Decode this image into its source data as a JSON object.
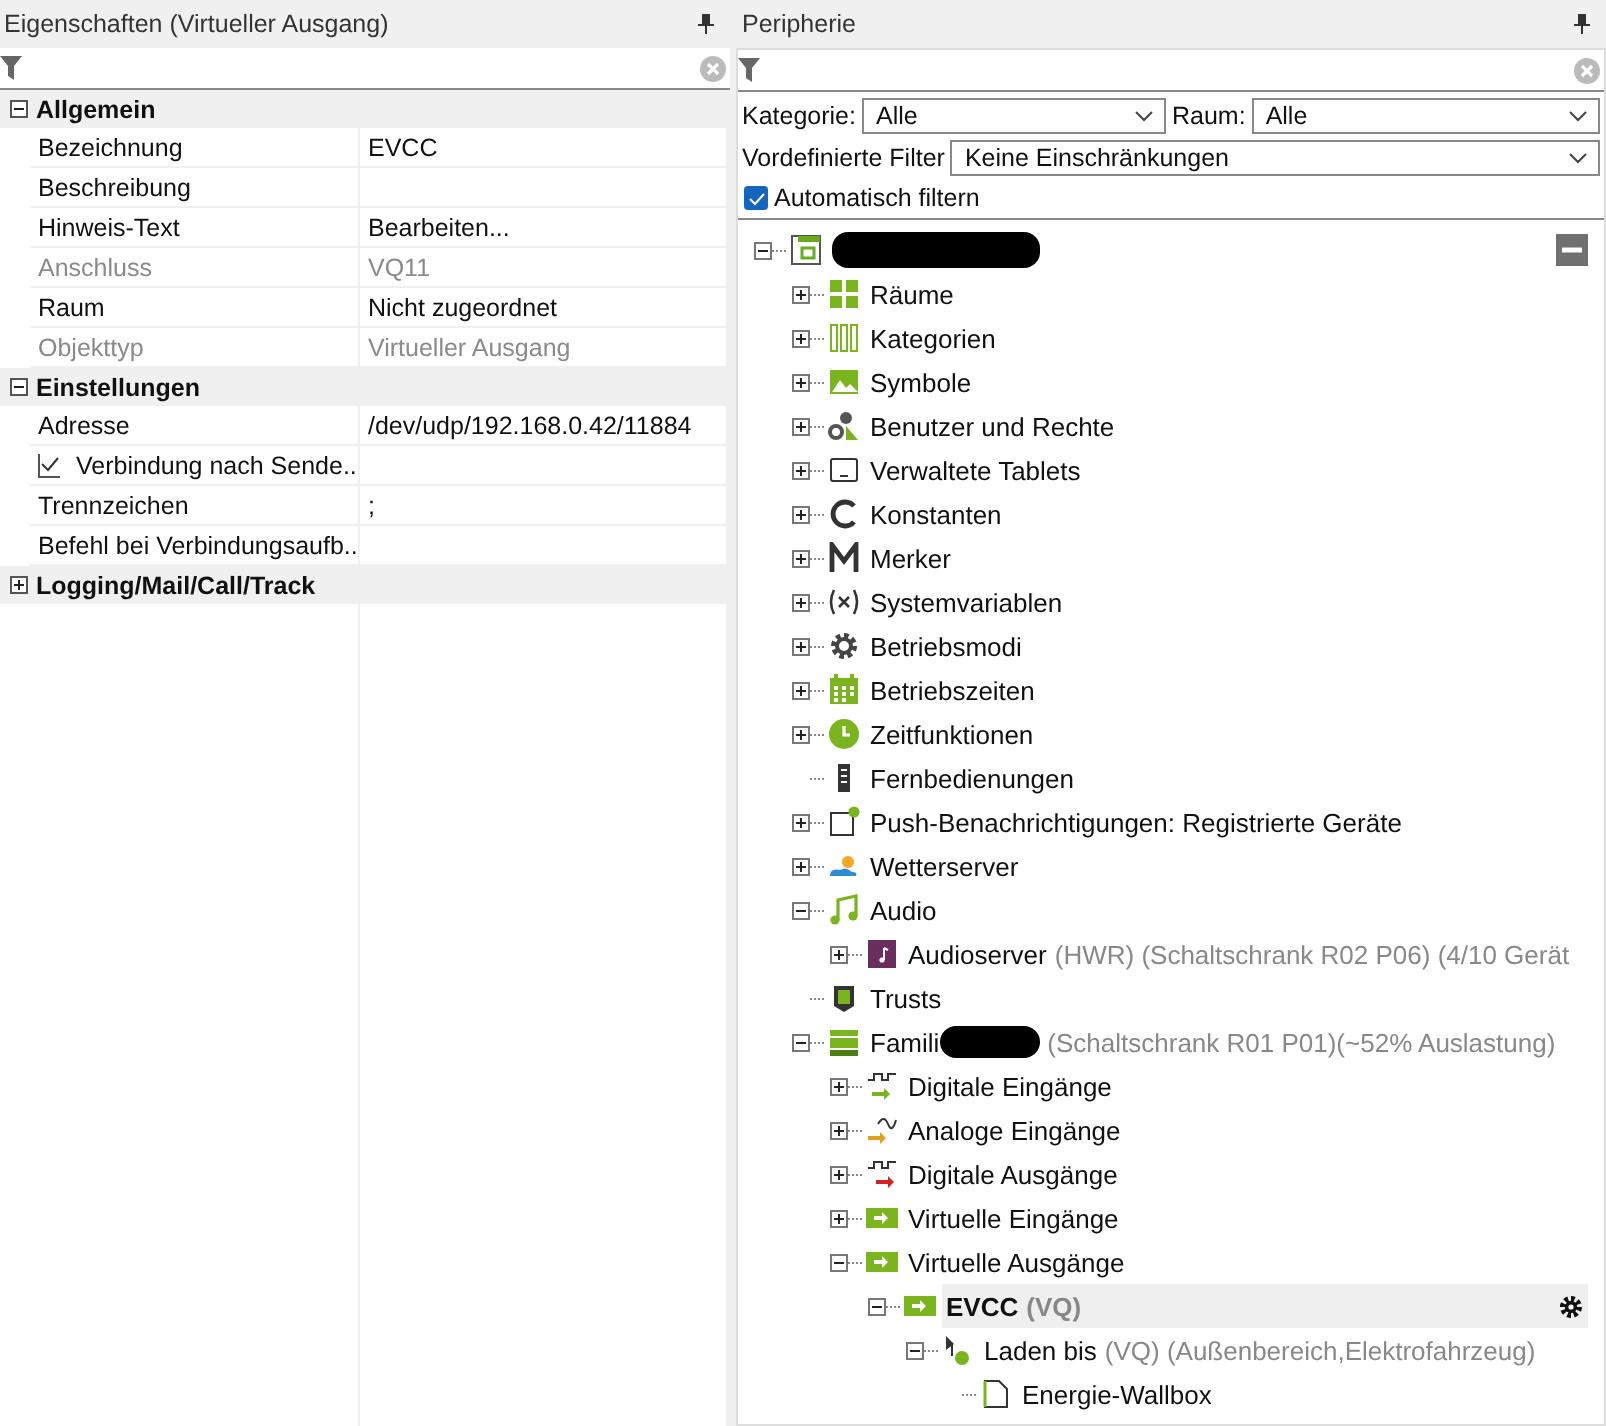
{
  "properties": {
    "title": "Eigenschaften (Virtueller Ausgang)",
    "sections": [
      {
        "title": "Allgemein",
        "expanded": true,
        "rows": [
          {
            "label": "Bezeichnung",
            "value": "EVCC",
            "disabled": false
          },
          {
            "label": "Beschreibung",
            "disabled": false
          },
          {
            "label": "Hinweis-Text",
            "value": "Bearbeiten...",
            "disabled": false
          },
          {
            "label": "Anschluss",
            "value": "VQ11",
            "disabled": true
          },
          {
            "label": "Raum",
            "value": "Nicht zugeordnet",
            "disabled": false
          },
          {
            "label": "Objekttyp",
            "value": "Virtueller Ausgang",
            "disabled": true
          }
        ]
      },
      {
        "title": "Einstellungen",
        "expanded": true,
        "rows": [
          {
            "label": "Adresse",
            "value": "/dev/udp/192.168.0.42/11884",
            "disabled": false
          },
          {
            "label": "Verbindung nach Sende...",
            "disabled": false,
            "checked": true
          },
          {
            "label": "Trennzeichen",
            "value": ";",
            "disabled": false
          },
          {
            "label": "Befehl bei Verbindungsaufb...",
            "disabled": false
          }
        ]
      },
      {
        "title": "Logging/Mail/Call/Track",
        "expanded": false
      }
    ]
  },
  "periphery": {
    "title": "Peripherie",
    "category": {
      "label": "Kategorie:",
      "value": "Alle"
    },
    "room": {
      "label": "Raum:",
      "value": "Alle"
    },
    "preset": {
      "label": "Vordefinierte Filter",
      "value": "Keine Einschränkungen"
    },
    "auto_filter": {
      "label": "Automatisch filtern",
      "checked": true
    },
    "tree": [
      {
        "kind": "root",
        "redacted": true,
        "expanded": true,
        "selected": false,
        "children": [
          {
            "kind": "rooms",
            "label": "Räume",
            "expanded": false,
            "selected": false
          },
          {
            "kind": "categories",
            "label": "Kategorien",
            "expanded": false,
            "selected": false
          },
          {
            "kind": "symbols",
            "label": "Symbole",
            "expanded": false,
            "selected": false
          },
          {
            "kind": "users",
            "label": "Benutzer und Rechte",
            "expanded": false,
            "selected": false
          },
          {
            "kind": "tablet",
            "label": "Verwaltete Tablets",
            "expanded": false,
            "selected": false
          },
          {
            "kind": "constant",
            "label": "Konstanten",
            "expanded": false,
            "selected": false
          },
          {
            "kind": "marker",
            "label": "Merker",
            "expanded": false,
            "selected": false
          },
          {
            "kind": "variable",
            "label": "Systemvariablen",
            "expanded": false,
            "selected": false
          },
          {
            "kind": "gear",
            "label": "Betriebsmodi",
            "expanded": false,
            "selected": false
          },
          {
            "kind": "calendar",
            "label": "Betriebszeiten",
            "expanded": false,
            "selected": false
          },
          {
            "kind": "clock",
            "label": "Zeitfunktionen",
            "expanded": false,
            "selected": false
          },
          {
            "kind": "remote",
            "label": "Fernbedienungen",
            "selected": false
          },
          {
            "kind": "push",
            "label": "Push-Benachrichtigungen: Registrierte Geräte",
            "expanded": false,
            "selected": false
          },
          {
            "kind": "weather",
            "label": "Wetterserver",
            "expanded": false,
            "selected": false
          },
          {
            "kind": "music",
            "label": "Audio",
            "expanded": true,
            "selected": false,
            "children": [
              {
                "kind": "audioserver",
                "label": "Audioserver",
                "detail": "(HWR) (Schaltschrank R02 P06) (4/10 Gerät",
                "expanded": false,
                "selected": false
              }
            ]
          },
          {
            "kind": "trust",
            "label": "Trusts",
            "selected": false
          },
          {
            "kind": "extension",
            "label": "Famili",
            "redacted": true,
            "detail": "(Schaltschrank R01 P01)(~52% Auslastung)",
            "expanded": true,
            "selected": false,
            "children": [
              {
                "kind": "digital_in",
                "label": "Digitale Eingänge",
                "expanded": false,
                "selected": false
              },
              {
                "kind": "analog_in",
                "label": "Analoge Eingänge",
                "expanded": false,
                "selected": false
              },
              {
                "kind": "digital_out",
                "label": "Digitale Ausgänge",
                "expanded": false,
                "selected": false
              },
              {
                "kind": "virtual",
                "label": "Virtuelle Eingänge",
                "expanded": false,
                "selected": false
              },
              {
                "kind": "virtual",
                "label": "Virtuelle Ausgänge",
                "expanded": true,
                "selected": false,
                "children": [
                  {
                    "kind": "virtual",
                    "label": "EVCC",
                    "detail": "(VQ)",
                    "expanded": true,
                    "selected": true,
                    "children": [
                      {
                        "kind": "command",
                        "label": "Laden bis",
                        "detail": "(VQ) (Außenbereich,Elektrofahrzeug)",
                        "expanded": true,
                        "selected": false,
                        "children": [
                          {
                            "kind": "page",
                            "label": "Energie-Wallbox",
                            "selected": false
                          }
                        ]
                      }
                    ]
                  }
                ]
              }
            ]
          }
        ]
      }
    ]
  }
}
